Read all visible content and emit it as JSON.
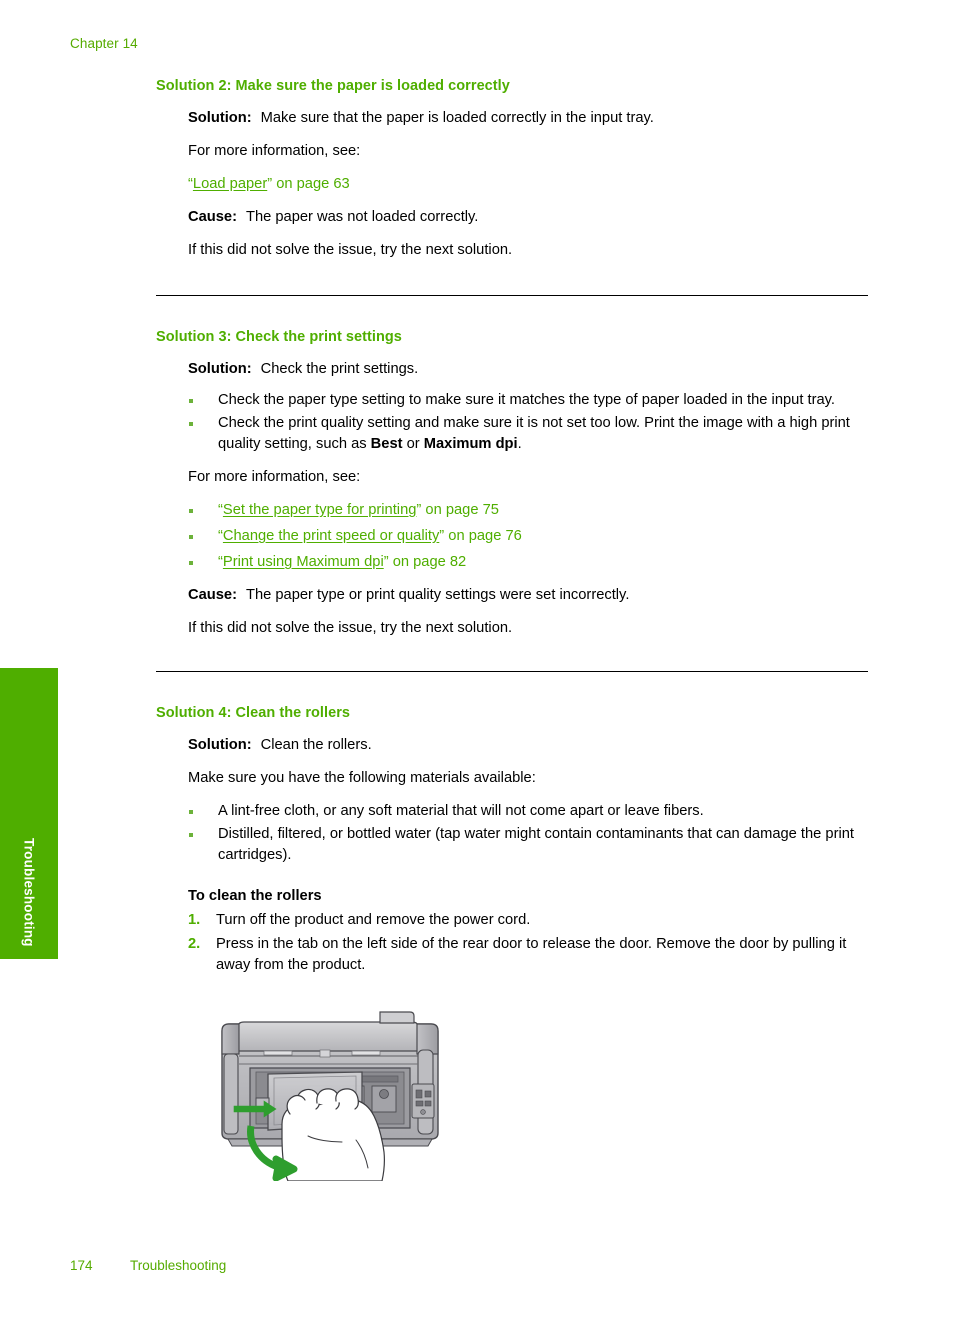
{
  "page": {
    "chapter": "Chapter 14",
    "side_tab": "Troubleshooting",
    "footer_page_number": "174",
    "footer_section": "Troubleshooting",
    "accent_green": "#4fae00",
    "bullet_green": "#6cb23a",
    "text_black": "#000000"
  },
  "sections": [
    {
      "heading": "Solution 2: Make sure the paper is loaded correctly",
      "solution_label": "Solution:",
      "solution_text": "Make sure that the paper is loaded correctly in the input tray.",
      "more_info": "For more information, see:",
      "link_open_quote": "“",
      "link_text": "Load paper",
      "link_close_quote": "”",
      "link_page": " on page 63",
      "cause_label": "Cause:",
      "cause_text": "The paper was not loaded correctly.",
      "next": "If this did not solve the issue, try the next solution."
    },
    {
      "heading": "Solution 3: Check the print settings",
      "solution_label": "Solution:",
      "solution_text": "Check the print settings.",
      "bullets": [
        {
          "pre": "Check the paper type setting to make sure it matches the type of paper loaded in the input tray.",
          "bold1": "",
          "mid": "",
          "bold2": "",
          "post": ""
        },
        {
          "pre": "Check the print quality setting and make sure it is not set too low. Print the image with a high print quality setting, such as ",
          "bold1": "Best",
          "mid": " or ",
          "bold2": "Maximum dpi",
          "post": "."
        }
      ],
      "more_info": "For more information, see:",
      "links": [
        {
          "open": "“",
          "text": "Set the paper type for printing",
          "close": "”",
          "page": " on page 75"
        },
        {
          "open": "“",
          "text": "Change the print speed or quality",
          "close": "”",
          "page": " on page 76"
        },
        {
          "open": "“",
          "text": "Print using Maximum dpi",
          "close": "”",
          "page": " on page 82"
        }
      ],
      "cause_label": "Cause:",
      "cause_text": "The paper type or print quality settings were set incorrectly.",
      "next": "If this did not solve the issue, try the next solution."
    },
    {
      "heading": "Solution 4: Clean the rollers",
      "solution_label": "Solution:",
      "solution_text": "Clean the rollers.",
      "materials_intro": "Make sure you have the following materials available:",
      "materials": [
        "A lint-free cloth, or any soft material that will not come apart or leave fibers.",
        "Distilled, filtered, or bottled water (tap water might contain contaminants that can damage the print cartridges)."
      ],
      "procedure_title": "To clean the rollers",
      "steps": [
        "Turn off the product and remove the power cord.",
        "Press in the tab on the left side of the rear door to release the door. Remove the door by pulling it away from the product."
      ]
    }
  ],
  "figure": {
    "name": "printer-rear-door-removal-illustration",
    "description": "Rear view of the printer with a hand pressing the tab and pulling the rear access door away",
    "arrow_color": "#2e9e2e"
  }
}
